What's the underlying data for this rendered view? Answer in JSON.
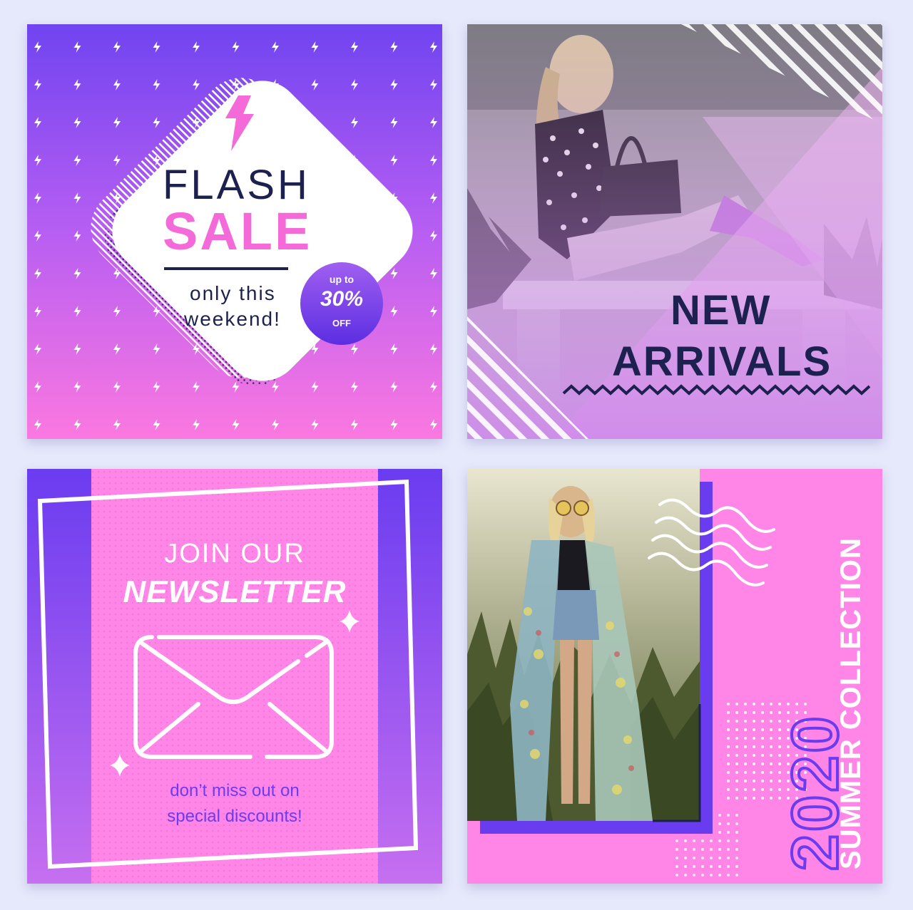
{
  "colors": {
    "navy": "#1d2150",
    "pink": "#f46ad8",
    "purple": "#6a3cf0",
    "background": "#e6e8fb"
  },
  "flash_sale": {
    "line1": "FLASH",
    "line2": "SALE",
    "subtitle_line1": "only this",
    "subtitle_line2": "weekend!",
    "badge_top": "up to",
    "badge_value": "30%",
    "badge_bottom": "OFF",
    "icon": "lightning-bolt-icon"
  },
  "new_arrivals": {
    "line1": "NEW",
    "line2": "ARRIVALS"
  },
  "newsletter": {
    "line1": "JOIN OUR",
    "line2": "NEWSLETTER",
    "tagline_line1": "don’t miss out on",
    "tagline_line2": "special discounts!",
    "icon": "envelope-icon"
  },
  "summer": {
    "year": "2020",
    "title": "SUMMER COLLECTION"
  }
}
